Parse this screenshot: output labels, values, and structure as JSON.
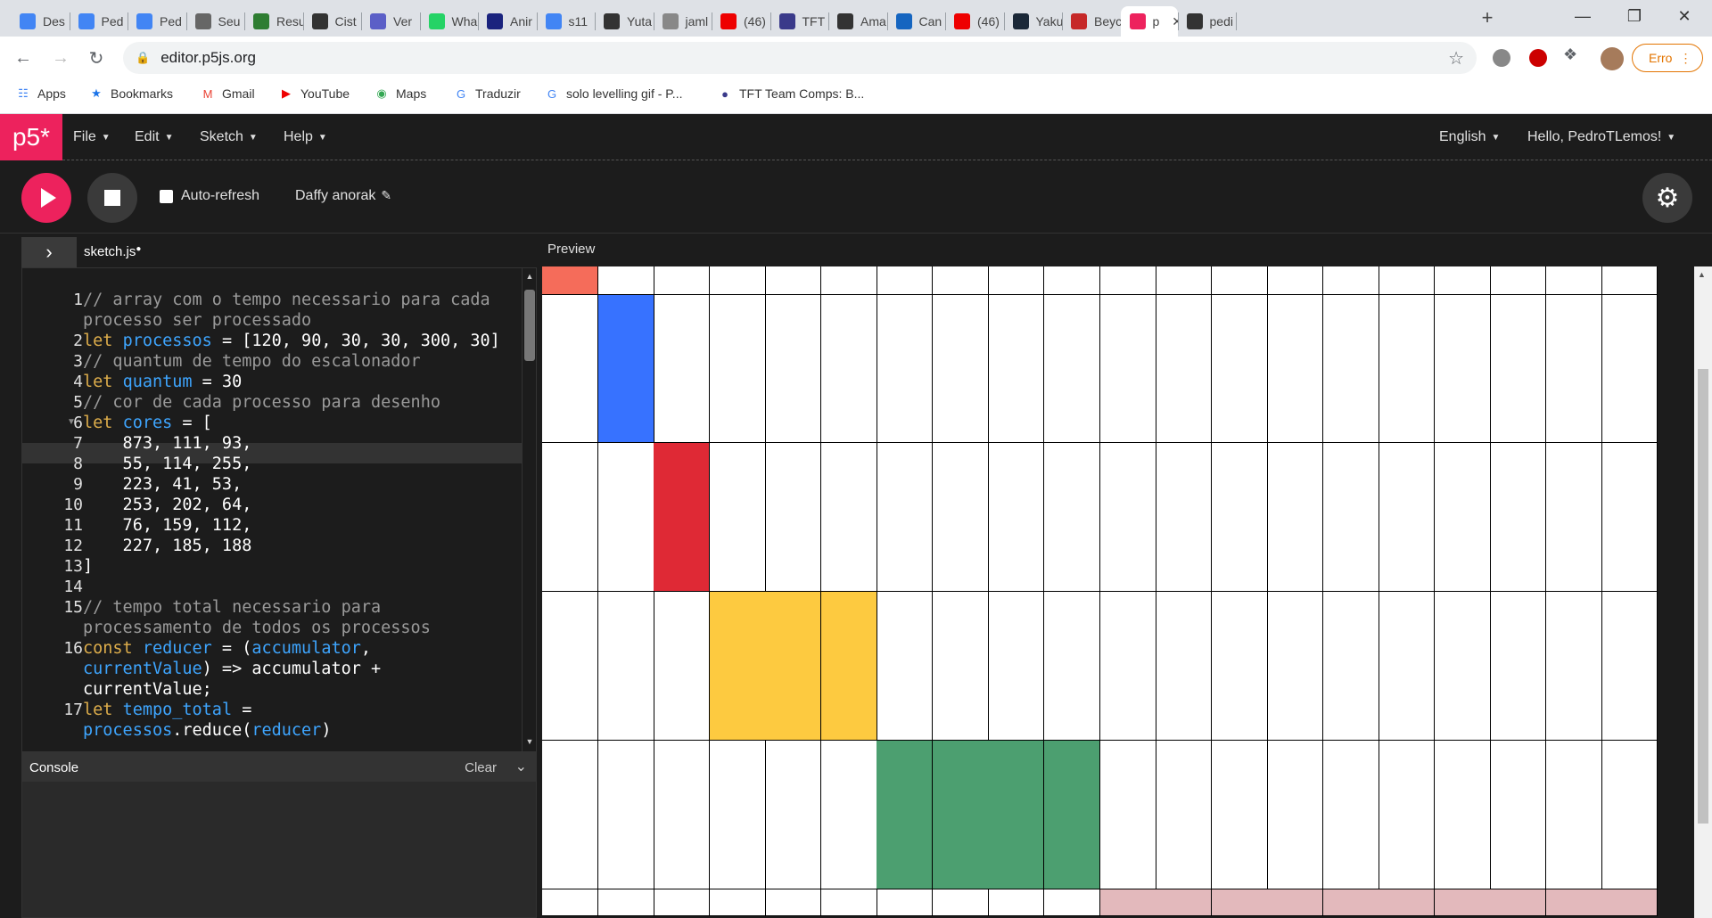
{
  "browser": {
    "tabs": [
      "Des",
      "Ped",
      "Ped",
      "Seu",
      "Resu",
      "Cist",
      "Ver",
      "Wha",
      "Anir",
      "s11",
      "Yuta",
      "jaml",
      "(46)",
      "TFT",
      "Ama",
      "Can",
      "(46)",
      "Yaku",
      "Beyc",
      "p",
      "pedi"
    ],
    "url": "editor.p5js.org",
    "profile_error_label": "Erro",
    "bookmarks": [
      "Apps",
      "Bookmarks",
      "Gmail",
      "YouTube",
      "Maps",
      "Traduzir",
      "solo levelling gif - P...",
      "TFT Team Comps: B..."
    ]
  },
  "p5": {
    "logo": "p5*",
    "menus": [
      "File",
      "Edit",
      "Sketch",
      "Help"
    ],
    "language": "English",
    "user": "Hello, PedroTLemos!",
    "auto_refresh_label": "Auto-refresh",
    "sketch_name": "Daffy anorak",
    "file_tab": "sketch.js",
    "preview_label": "Preview",
    "console_label": "Console",
    "clear_label": "Clear"
  },
  "code_lines": [
    {
      "n": "1",
      "segs": [
        [
          "cm",
          "// array com o tempo necessario para cada"
        ]
      ]
    },
    {
      "n": "",
      "segs": [
        [
          "cm",
          "processo ser processado"
        ]
      ]
    },
    {
      "n": "2",
      "segs": [
        [
          "kw",
          "let "
        ],
        [
          "var",
          "processos"
        ],
        [
          "pl",
          " = [120, 90, 30, 30, 300, 30]"
        ]
      ]
    },
    {
      "n": "3",
      "segs": [
        [
          "cm",
          "// quantum de tempo do escalonador"
        ]
      ]
    },
    {
      "n": "4",
      "segs": [
        [
          "kw",
          "let "
        ],
        [
          "var",
          "quantum"
        ],
        [
          "pl",
          " = 30"
        ]
      ]
    },
    {
      "n": "5",
      "segs": [
        [
          "cm",
          "// cor de cada processo para desenho"
        ]
      ]
    },
    {
      "n": "6",
      "segs": [
        [
          "kw",
          "let "
        ],
        [
          "var",
          "cores"
        ],
        [
          "pl",
          " = ["
        ]
      ]
    },
    {
      "n": "7",
      "segs": [
        [
          "pl",
          "    873, 111, 93,"
        ]
      ]
    },
    {
      "n": "8",
      "segs": [
        [
          "pl",
          "    55, 114, 255,"
        ]
      ]
    },
    {
      "n": "9",
      "segs": [
        [
          "pl",
          "    223, 41, 53,"
        ]
      ]
    },
    {
      "n": "10",
      "segs": [
        [
          "pl",
          "    253, 202, 64,"
        ]
      ]
    },
    {
      "n": "11",
      "segs": [
        [
          "pl",
          "    76, 159, 112,"
        ]
      ]
    },
    {
      "n": "12",
      "segs": [
        [
          "pl",
          "    227, 185, 188"
        ]
      ]
    },
    {
      "n": "13",
      "segs": [
        [
          "pl",
          "]"
        ]
      ]
    },
    {
      "n": "14",
      "segs": []
    },
    {
      "n": "15",
      "segs": [
        [
          "cm",
          "// tempo total necessario para"
        ]
      ]
    },
    {
      "n": "",
      "segs": [
        [
          "cm",
          "processamento de todos os processos"
        ]
      ]
    },
    {
      "n": "16",
      "segs": [
        [
          "kw",
          "const "
        ],
        [
          "var",
          "reducer"
        ],
        [
          "pl",
          " = ("
        ],
        [
          "var",
          "accumulator"
        ],
        [
          "pl",
          ","
        ]
      ]
    },
    {
      "n": "",
      "segs": [
        [
          "var",
          "currentValue"
        ],
        [
          "pl",
          ") => accumulator +"
        ]
      ]
    },
    {
      "n": "",
      "segs": [
        [
          "pl",
          "currentValue;"
        ]
      ]
    },
    {
      "n": "17",
      "segs": [
        [
          "kw",
          "let "
        ],
        [
          "var",
          "tempo_total"
        ],
        [
          "pl",
          " ="
        ]
      ]
    },
    {
      "n": "",
      "segs": [
        [
          "var",
          "processos"
        ],
        [
          "pl",
          ".reduce("
        ],
        [
          "var",
          "reducer"
        ],
        [
          "pl",
          ")"
        ]
      ]
    }
  ],
  "grid": {
    "columns": 20,
    "row_heights_units": [
      1,
      5.3,
      5.3,
      5.3,
      5.3,
      1
    ],
    "blocks": [
      {
        "row": 0,
        "cols": [
          0
        ],
        "color": "#f56c5a"
      },
      {
        "row": 1,
        "cols": [
          1
        ],
        "color": "#3772ff"
      },
      {
        "row": 2,
        "cols": [
          2
        ],
        "color": "#df2935"
      },
      {
        "row": 3,
        "cols": [
          3,
          4,
          5
        ],
        "color": "#fdca40"
      },
      {
        "row": 4,
        "cols": [
          6,
          7,
          8,
          9
        ],
        "color": "#4c9f70"
      },
      {
        "row": 5,
        "cols": [
          10,
          11,
          12,
          13,
          14,
          15,
          16,
          17,
          18,
          19
        ],
        "color": "#e3b9bc"
      }
    ]
  },
  "colors": {
    "p5_pink": "#ed225d",
    "editor_bg": "#1c1c1c"
  }
}
